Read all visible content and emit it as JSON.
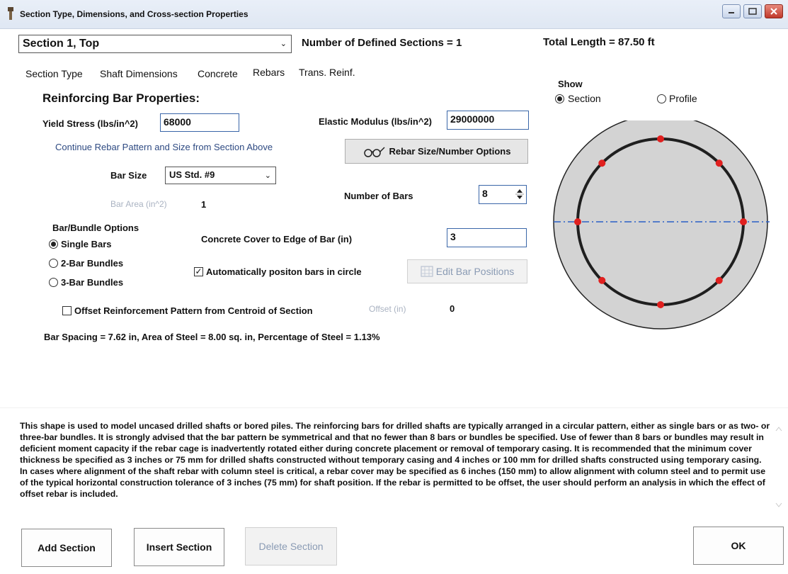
{
  "window": {
    "title": "Section Type, Dimensions, and Cross-section Properties"
  },
  "header": {
    "section_select": "Section 1, Top",
    "defined_sections": "Number of Defined Sections = 1",
    "total_length": "Total Length = 87.50 ft"
  },
  "tabs": [
    "Section Type",
    "Shaft Dimensions",
    "Concrete",
    "Rebars",
    "Trans. Reinf."
  ],
  "rebar": {
    "heading": "Reinforcing Bar Properties:",
    "yield_label": "Yield Stress (lbs/in^2)",
    "yield_value": "68000",
    "elastic_label": "Elastic Modulus (lbs/in^2)",
    "elastic_value": "29000000",
    "continue_text": "Continue Rebar Pattern and Size from Section Above",
    "size_options_btn": "Rebar Size/Number Options",
    "bar_size_label": "Bar Size",
    "bar_size_value": "US Std. #9",
    "bar_area_label": "Bar Area (in^2)",
    "bar_area_value": "1",
    "num_bars_label": "Number of Bars",
    "num_bars_value": "8",
    "bundle_heading": "Bar/Bundle Options",
    "bundle_options": [
      "Single Bars",
      "2-Bar Bundles",
      "3-Bar Bundles"
    ],
    "cover_label": "Concrete Cover to Edge of Bar (in)",
    "cover_value": "3",
    "auto_position_label": "Automatically positon bars in circle",
    "edit_positions_btn": "Edit Bar Positions",
    "offset_label": "Offset Reinforcement Pattern from Centroid of Section",
    "offset_in_label": "Offset (in)",
    "offset_value": "0",
    "summary": "Bar Spacing = 7.62 in, Area of Steel = 8.00 sq. in, Percentage of Steel = 1.13%"
  },
  "show": {
    "label": "Show",
    "options": [
      "Section",
      "Profile"
    ],
    "selected": "Section"
  },
  "diagram": {
    "bar_count": 8,
    "concrete_color": "#d3d3d3",
    "cage_color": "#1f1f1f",
    "bar_color": "#e0201f",
    "axis_color": "#2b5fc7"
  },
  "description": "This shape is used to model uncased drilled shafts or bored piles. The reinforcing bars for drilled shafts are typically arranged in a circular pattern, either as single bars or as two- or three-bar bundles. It is strongly advised that the bar pattern be symmetrical and that no fewer than 8 bars or bundles be specified. Use of fewer than 8 bars or bundles may result in deficient moment capacity if the rebar cage is inadvertently rotated either during concrete placement or removal of temporary casing. It is recommended that the minimum cover thickness be specified as 3 inches or 75 mm for drilled shafts constructed without temporary casing and 4 inches or 100 mm for drilled shafts constructed using temporary casing. In cases where alignment of the shaft rebar with column steel is critical, a rebar cover may be specified as 6 inches (150 mm) to allow alignment with column steel and to permit use of the typical horizontal construction tolerance of 3 inches (75 mm) for shaft position. If the rebar is permitted to be offset, the user should perform an analysis in which the effect of offset rebar is included.",
  "buttons": {
    "add": "Add Section",
    "insert": "Insert Section",
    "delete": "Delete Section",
    "ok": "OK"
  }
}
